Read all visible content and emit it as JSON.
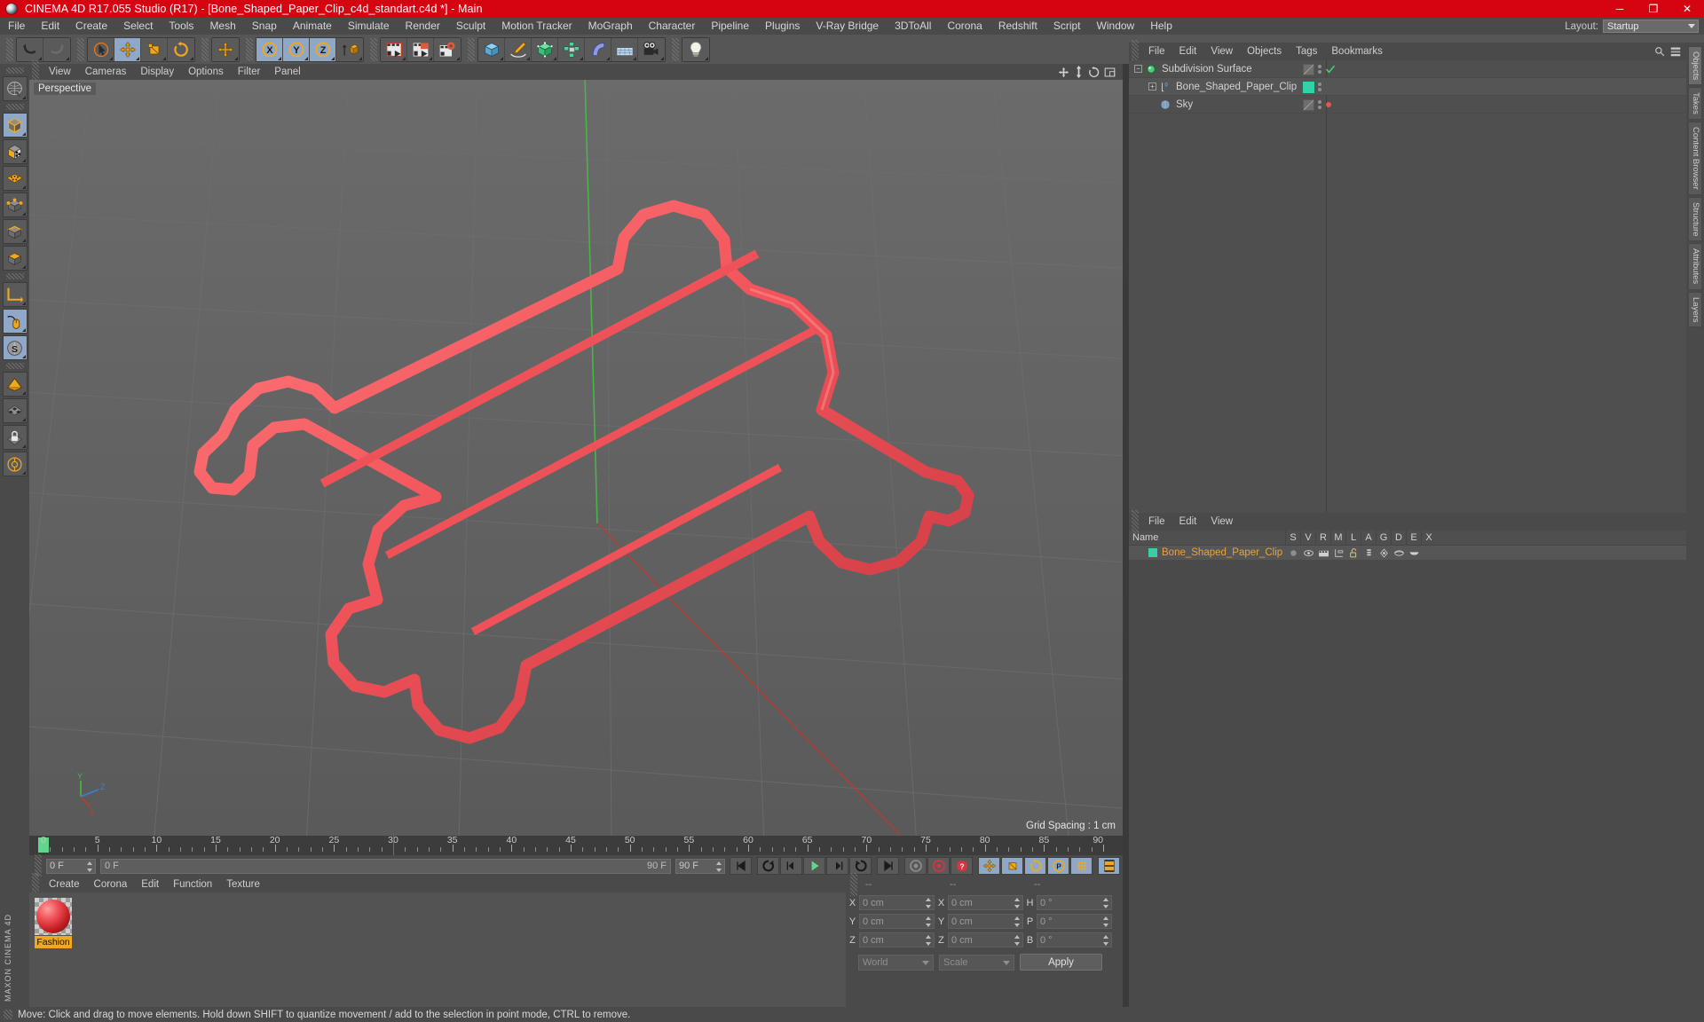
{
  "window": {
    "title": "CINEMA 4D R17.055 Studio (R17) - [Bone_Shaped_Paper_Clip_c4d_standart.c4d *] - Main",
    "minimize": "─",
    "maximize": "❐",
    "close": "✕",
    "accent_color": "#d40511"
  },
  "menubar": {
    "items": [
      "File",
      "Edit",
      "Create",
      "Select",
      "Tools",
      "Mesh",
      "Snap",
      "Animate",
      "Simulate",
      "Render",
      "Sculpt",
      "Motion Tracker",
      "MoGraph",
      "Character",
      "Pipeline",
      "Plugins",
      "V-Ray Bridge",
      "3DToAll",
      "Corona",
      "Redshift",
      "Script",
      "Window",
      "Help"
    ],
    "layout_label": "Layout:",
    "layout_value": "Startup"
  },
  "toolbar": {
    "groups": [
      {
        "name": "history",
        "buttons": [
          {
            "icon": "undo-icon",
            "active": false
          },
          {
            "icon": "redo-icon",
            "active": false
          }
        ]
      },
      {
        "name": "transform",
        "buttons": [
          {
            "icon": "select-cursor-icon",
            "active": false
          },
          {
            "icon": "move-icon",
            "active": true
          },
          {
            "icon": "scale-icon",
            "active": false
          },
          {
            "icon": "rotate-icon",
            "active": false
          }
        ]
      },
      {
        "name": "move-dup",
        "buttons": [
          {
            "icon": "move-icon",
            "active": false
          }
        ]
      },
      {
        "name": "axis-locks",
        "buttons": [
          {
            "icon": "axis-x-icon",
            "active": true
          },
          {
            "icon": "axis-y-icon",
            "active": true
          },
          {
            "icon": "axis-z-icon",
            "active": true
          },
          {
            "icon": "world-coord-icon",
            "active": false
          }
        ]
      },
      {
        "name": "render",
        "buttons": [
          {
            "icon": "render-view-icon",
            "active": false
          },
          {
            "icon": "render-region-icon",
            "active": false
          },
          {
            "icon": "render-settings-icon",
            "active": false
          }
        ]
      },
      {
        "name": "create",
        "buttons": [
          {
            "icon": "cube-primitive-icon",
            "active": false
          },
          {
            "icon": "spline-pen-icon",
            "active": false
          },
          {
            "icon": "generator-icon",
            "active": false
          },
          {
            "icon": "array-icon",
            "active": false
          },
          {
            "icon": "deformer-bend-icon",
            "active": false
          },
          {
            "icon": "floor-environment-icon",
            "active": false
          },
          {
            "icon": "camera-icon",
            "active": false
          }
        ]
      },
      {
        "name": "light",
        "buttons": [
          {
            "icon": "light-icon",
            "active": false
          }
        ]
      }
    ]
  },
  "left_toolbar": {
    "buttons": [
      {
        "icon": "live-selection-icon",
        "active": false
      },
      {
        "icon": "model-mode-cube-icon",
        "active": true
      },
      {
        "icon": "texture-mode-icon",
        "active": false
      },
      {
        "icon": "polygon-mode-icon",
        "active": false
      },
      {
        "icon": "point-mode-icon",
        "active": false
      },
      {
        "icon": "edge-mode-icon",
        "active": false
      },
      {
        "icon": "object-mode-icon",
        "active": false
      },
      {
        "icon": "axis-modify-icon",
        "active": false
      },
      {
        "icon": "enable-snapping-mouse-icon",
        "active": true
      },
      {
        "icon": "snap-settings-s-icon",
        "active": true
      },
      {
        "icon": "workplane-icon",
        "active": false
      },
      {
        "icon": "texture-checker-icon",
        "active": false
      },
      {
        "icon": "lock-workplane-icon",
        "active": false
      },
      {
        "icon": "planar-workplane-icon",
        "active": false
      }
    ],
    "brand": "MAXON CINEMA 4D"
  },
  "viewport": {
    "menu": [
      "View",
      "Cameras",
      "Display",
      "Options",
      "Filter",
      "Panel"
    ],
    "icons": [
      "move-view-icon",
      "pan-view-icon",
      "rotate-view-icon",
      "maximize-view-icon"
    ],
    "label": "Perspective",
    "grid_spacing": "Grid Spacing : 1 cm",
    "axis_gizmo": {
      "x": "X",
      "y": "Y",
      "z": "Z"
    },
    "object_color": "#f2545b"
  },
  "timeline": {
    "ticks_major": [
      0,
      5,
      10,
      15,
      20,
      25,
      30,
      35,
      40,
      45,
      50,
      55,
      60,
      65,
      70,
      75,
      80,
      85,
      90
    ],
    "range_start": 0,
    "range_end": 90,
    "current_frame": "0 F",
    "start_field": "0 F",
    "bar_left_label": "0 F",
    "bar_right_label": "90 F",
    "end_field": "90 F",
    "frame_field": "0 F"
  },
  "transport": {
    "buttons": [
      {
        "icon": "goto-start-icon",
        "active": false
      },
      {
        "icon": "play-backwards-loop-icon",
        "active": false
      },
      {
        "icon": "previous-key-icon",
        "active": false
      },
      {
        "icon": "play-forward-icon",
        "active": false
      },
      {
        "icon": "next-key-icon",
        "active": false
      },
      {
        "icon": "loop-icon",
        "active": false
      },
      {
        "icon": "goto-end-icon",
        "active": false
      },
      {
        "icon": "record-active-objects-icon",
        "active": false
      },
      {
        "icon": "autokeying-icon",
        "active": false
      },
      {
        "icon": "keyframe-selection-icon",
        "active": false
      },
      {
        "icon": "key-position-icon",
        "active": true
      },
      {
        "icon": "key-scale-icon",
        "active": true
      },
      {
        "icon": "key-rotation-icon",
        "active": true
      },
      {
        "icon": "key-parameter-icon",
        "active": true
      },
      {
        "icon": "key-pla-icon",
        "active": true
      },
      {
        "icon": "timeline-window-icon",
        "active": true
      }
    ]
  },
  "material_manager": {
    "menu": [
      "Create",
      "Corona",
      "Edit",
      "Function",
      "Texture"
    ],
    "materials": [
      {
        "name": "Fashion",
        "color": "#e03c3c",
        "selected": true
      }
    ]
  },
  "coordinates": {
    "header": [
      "--",
      "--",
      "--"
    ],
    "rows": [
      {
        "pos_label": "X",
        "pos_value": "0 cm",
        "size_label": "X",
        "size_value": "0 cm",
        "rot_label": "H",
        "rot_value": "0 °"
      },
      {
        "pos_label": "Y",
        "pos_value": "0 cm",
        "size_label": "Y",
        "size_value": "0 cm",
        "rot_label": "P",
        "rot_value": "0 °"
      },
      {
        "pos_label": "Z",
        "pos_value": "0 cm",
        "size_label": "Z",
        "size_value": "0 cm",
        "rot_label": "B",
        "rot_value": "0 °"
      }
    ],
    "system": "World",
    "mode": "Scale",
    "apply": "Apply"
  },
  "object_manager": {
    "menu": [
      "File",
      "Edit",
      "View",
      "Objects",
      "Tags",
      "Bookmarks"
    ],
    "objects": [
      {
        "name": "Subdivision Surface",
        "icon": "subdivision-surface-icon",
        "depth": 0,
        "expander": "−",
        "tag_color": "hatch",
        "enabled_marker": "check",
        "marker_color": "#49d17a"
      },
      {
        "name": "Bone_Shaped_Paper_Clip",
        "icon": "polygon-object-icon",
        "depth": 1,
        "expander": "+",
        "tag_color": "#2fd3a5",
        "enabled_marker": "none",
        "marker_color": ""
      },
      {
        "name": "Sky",
        "icon": "sky-object-icon",
        "depth": 1,
        "expander": "",
        "tag_color": "hatch",
        "enabled_marker": "dot",
        "marker_color": "#e05a4a"
      }
    ]
  },
  "attribute_manager": {
    "menu": [
      "File",
      "Edit",
      "View"
    ],
    "columns": [
      "Name",
      "S",
      "V",
      "R",
      "M",
      "L",
      "A",
      "G",
      "D",
      "E",
      "X"
    ],
    "rows": [
      {
        "name": "Bone_Shaped_Paper_Clip",
        "swatch": "#2fd3a5",
        "icons": [
          "dot-icon",
          "visibility-icon",
          "render-icon",
          "hierarchy-icon",
          "unlock-icon",
          "animate-icon",
          "generator-icon",
          "deform-icon",
          "expression-icon"
        ]
      }
    ]
  },
  "right_tabs": [
    {
      "label": "Objects",
      "active": true
    },
    {
      "label": "Takes",
      "active": false
    },
    {
      "label": "Content Browser",
      "active": false
    },
    {
      "label": "Structure",
      "active": false
    },
    {
      "label": "Attributes",
      "active": false
    },
    {
      "label": "Layers",
      "active": false
    }
  ],
  "statusbar": {
    "message": "Move: Click and drag to move elements. Hold down SHIFT to quantize movement / add to the selection in point mode, CTRL to remove."
  }
}
